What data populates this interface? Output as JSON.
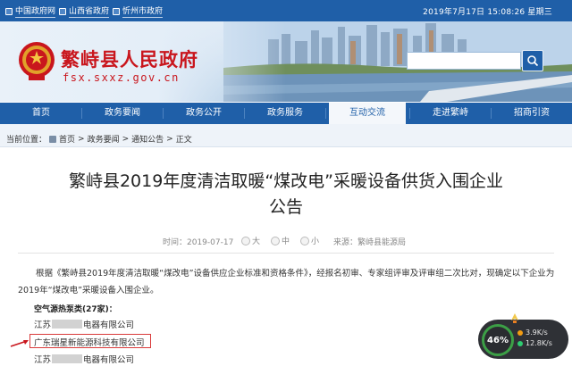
{
  "topbar": {
    "links": [
      "中国政府网",
      "山西省政府",
      "忻州市政府"
    ],
    "datetime": "2019年7月17日  15:08:26  星期三"
  },
  "banner": {
    "title": "繁峙县人民政府",
    "domain": "fsx.sxxz.gov.cn",
    "search_placeholder": ""
  },
  "nav": {
    "items": [
      "首页",
      "政务要闻",
      "政务公开",
      "政务服务",
      "互动交流",
      "走进繁峙",
      "招商引资"
    ],
    "active": "互动交流"
  },
  "breadcrumb": {
    "prefix": "当前位置：",
    "items": [
      "首页",
      "政务要闻",
      "通知公告",
      "正文"
    ],
    "sep": ">"
  },
  "article": {
    "title": "繁峙县2019年度清洁取暖“煤改电”采暖设备供货入围企业公告",
    "time_label": "时间：2019-07-17",
    "font_sizes": [
      "大",
      "中",
      "小"
    ],
    "source": "来源：繁峙县能源局",
    "paragraph": "根据《繁峙县2019年度清洁取暖“煤改电”设备供应企业标准和资格条件》，经报名初审、专家组评审及评审组二次比对，现确定以下企业为2019年“煤改电”采暖设备入围企业。",
    "section": "空气源热泵类(27家)：",
    "companies": [
      {
        "prefix": "江苏",
        "suffix": "电器有限公司"
      },
      {
        "prefix": "广东瑞星新能源科技有限公司",
        "suffix": ""
      },
      {
        "prefix": "江苏",
        "suffix": "电器有限公司"
      }
    ]
  },
  "widget": {
    "percent": "46%",
    "up": "3.9K/s",
    "down": "12.8K/s"
  },
  "colors": {
    "brand_blue": "#1f5fa8",
    "title_red": "#c9161d",
    "highlight_red": "#d93a3a"
  }
}
